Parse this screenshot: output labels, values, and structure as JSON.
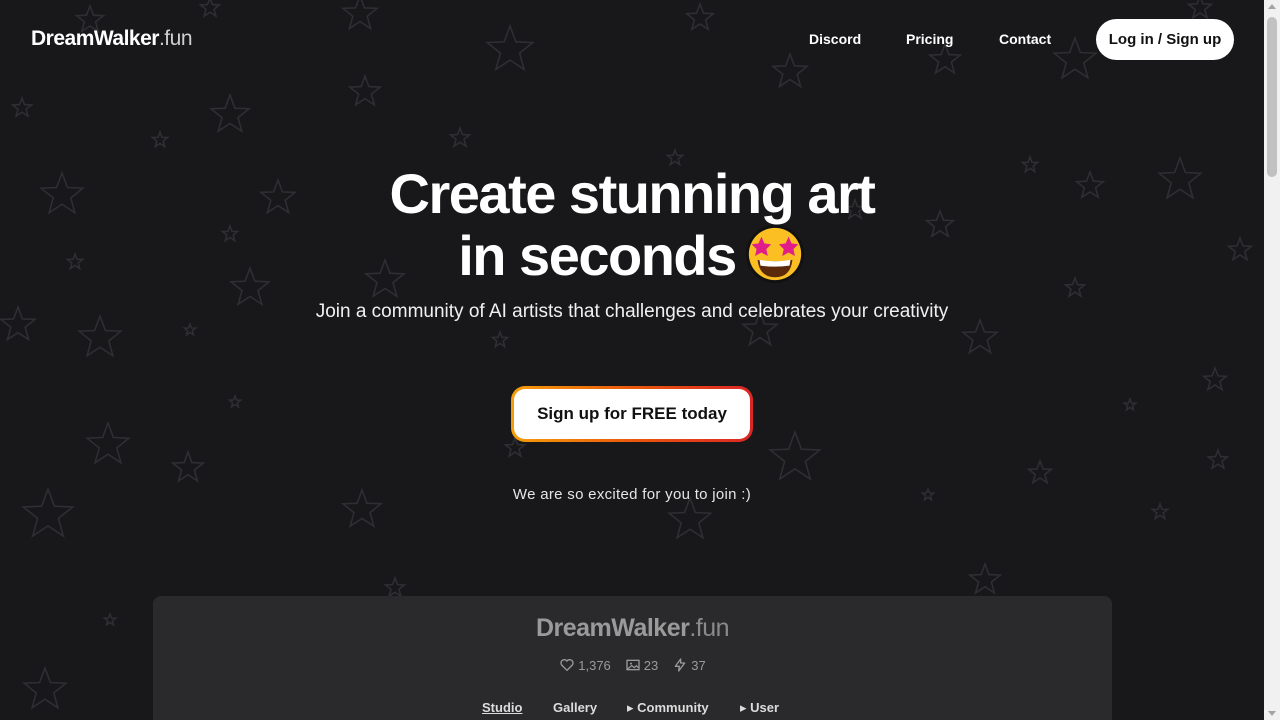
{
  "header": {
    "logo_main": "DreamWalker",
    "logo_tld": ".fun",
    "nav": [
      "Discord",
      "Pricing",
      "Contact"
    ],
    "login_label": "Log in / Sign up"
  },
  "hero": {
    "title_line1": "Create stunning art",
    "title_line2": "in seconds",
    "emoji_icon": "star-struck-emoji",
    "subtitle": "Join a community of AI artists that challenges and celebrates your creativity",
    "cta_label": "Sign up for FREE today",
    "note": "We are so excited for you to join :)"
  },
  "preview": {
    "logo_main": "DreamWalker",
    "logo_tld": ".fun",
    "stats": {
      "likes": "1,376",
      "images": "23",
      "energy": "37"
    },
    "nav": {
      "studio": "Studio",
      "gallery": "Gallery",
      "community": "▸ Community",
      "user": "▸ User"
    }
  },
  "colors": {
    "background": "#18181b",
    "cta_gradient_start": "#f59e0b",
    "cta_gradient_end": "#dc2626",
    "preview_panel": "#2a2a2c"
  }
}
